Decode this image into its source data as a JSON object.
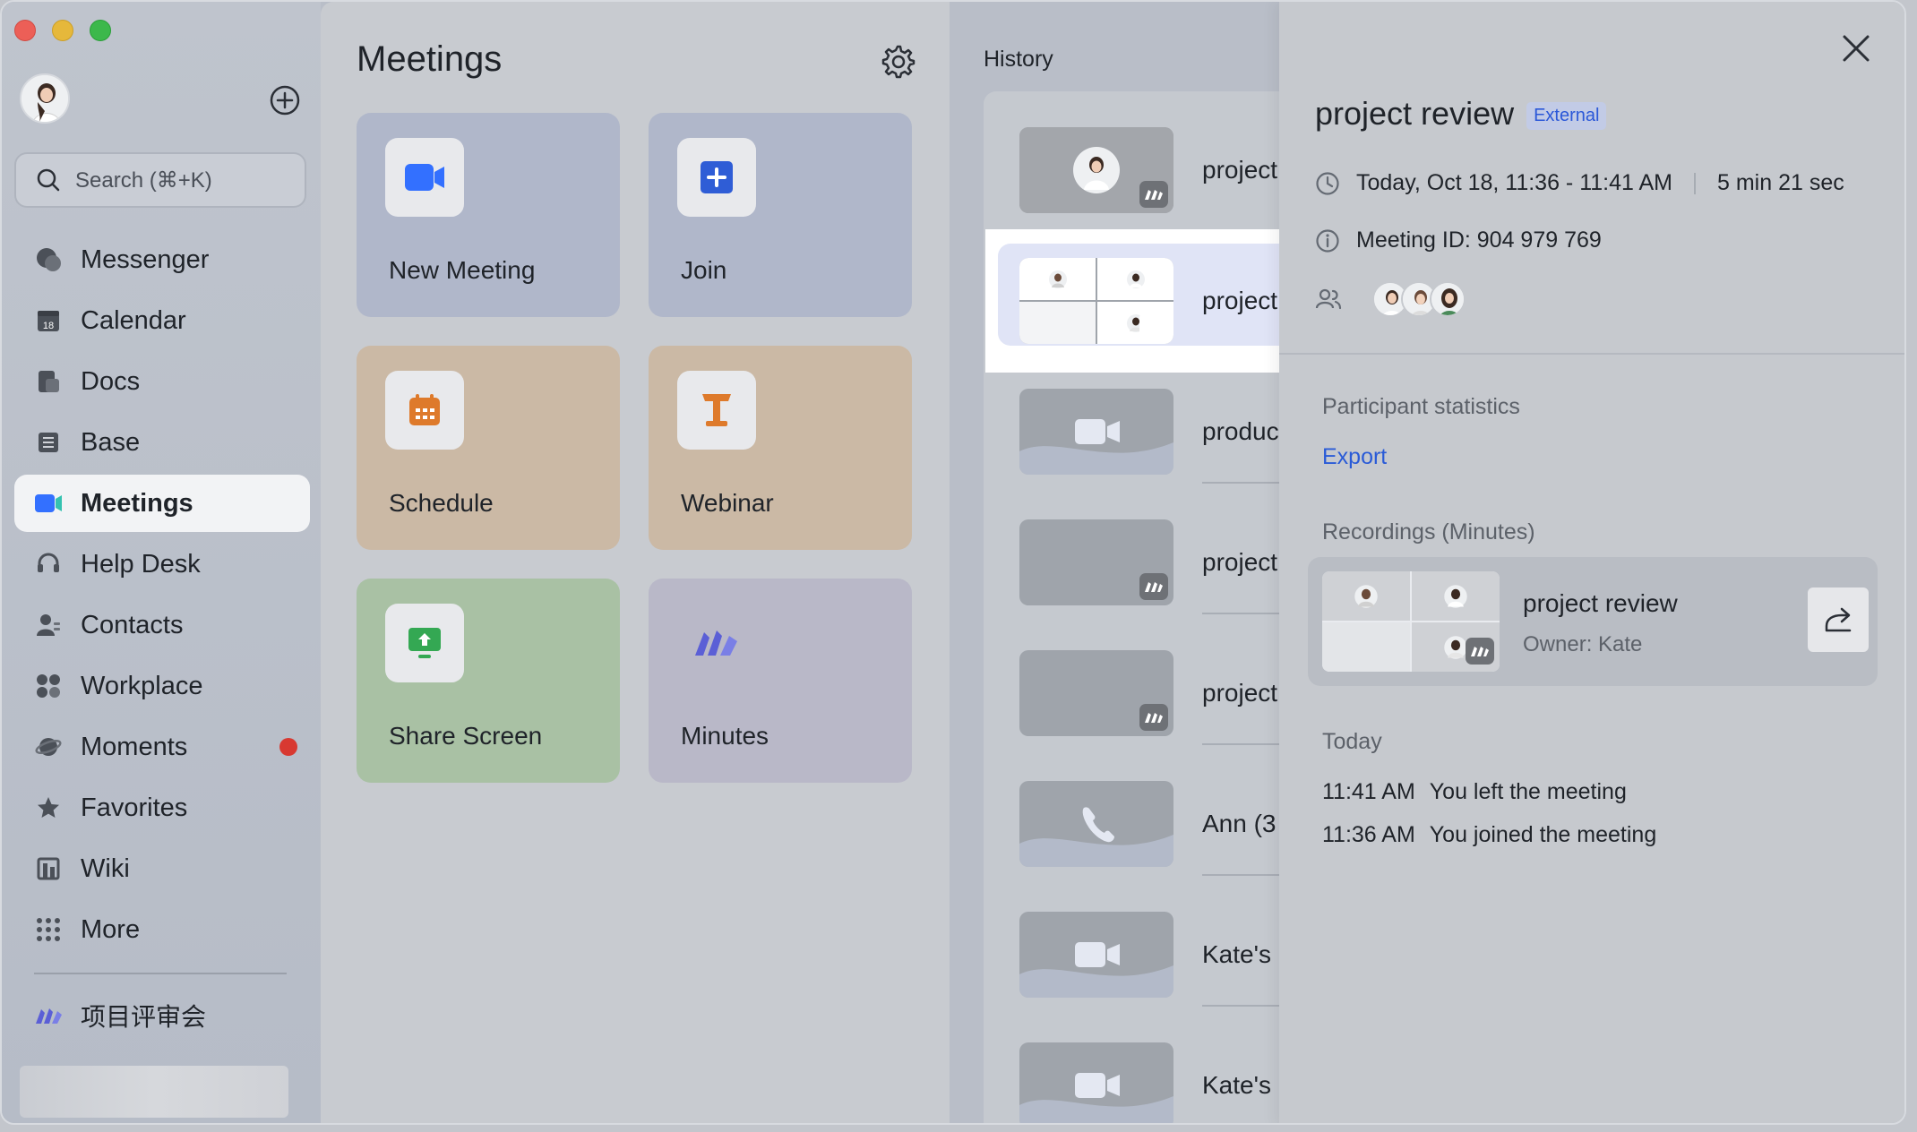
{
  "sidebar": {
    "search_placeholder": "Search (⌘+K)",
    "items": [
      {
        "label": "Messenger",
        "icon": "messenger-icon"
      },
      {
        "label": "Calendar",
        "icon": "calendar-icon"
      },
      {
        "label": "Docs",
        "icon": "docs-icon"
      },
      {
        "label": "Base",
        "icon": "base-icon"
      },
      {
        "label": "Meetings",
        "icon": "meetings-icon",
        "active": true
      },
      {
        "label": "Help Desk",
        "icon": "help-desk-icon"
      },
      {
        "label": "Contacts",
        "icon": "contacts-icon"
      },
      {
        "label": "Workplace",
        "icon": "workplace-icon"
      },
      {
        "label": "Moments",
        "icon": "moments-icon",
        "badge": true
      },
      {
        "label": "Favorites",
        "icon": "star-icon"
      },
      {
        "label": "Wiki",
        "icon": "wiki-icon"
      },
      {
        "label": "More",
        "icon": "more-grid-icon"
      }
    ],
    "calendar_day": "18",
    "minutes_entry": "项目评审会"
  },
  "meetings": {
    "title": "Meetings",
    "tiles": {
      "new_meeting": "New Meeting",
      "join": "Join",
      "schedule": "Schedule",
      "webinar": "Webinar",
      "share_screen": "Share Screen",
      "minutes": "Minutes"
    }
  },
  "history": {
    "label": "History",
    "rows": [
      {
        "name": "project"
      },
      {
        "name": "project"
      },
      {
        "name": "produc"
      },
      {
        "name": "project"
      },
      {
        "name": "project"
      },
      {
        "name": "Ann (3"
      },
      {
        "name": "Kate's"
      },
      {
        "name": "Kate's"
      }
    ]
  },
  "detail": {
    "title": "project review",
    "tag": "External",
    "time": "Today, Oct 18, 11:36 - 11:41 AM",
    "duration": "5 min 21 sec",
    "meeting_id": "Meeting ID: 904 979 769",
    "participant_stats_label": "Participant statistics",
    "export_label": "Export",
    "recordings_label": "Recordings (Minutes)",
    "recording": {
      "title": "project review",
      "owner": "Owner: Kate"
    },
    "today_label": "Today",
    "log": [
      {
        "time": "11:41 AM",
        "text": "You left the meeting"
      },
      {
        "time": "11:36 AM",
        "text": "You joined the meeting"
      }
    ]
  },
  "colors": {
    "accent": "#2a5bd7",
    "badge": "#d83931",
    "meetings_icon": "#3370ff",
    "schedule_icon": "#de7a2b",
    "share_icon": "#34a853",
    "minutes_icon": "#5b5fd6"
  }
}
